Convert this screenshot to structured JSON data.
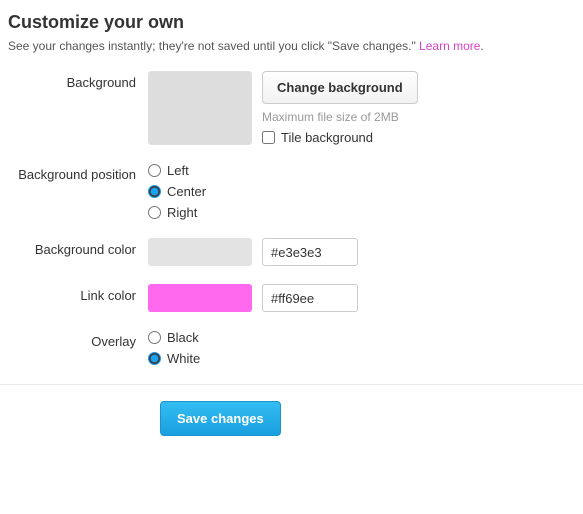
{
  "heading": "Customize your own",
  "sub_text": "See your changes instantly; they're not saved until you click \"Save changes.\" ",
  "learn_more": "Learn more",
  "rows": {
    "background": {
      "label": "Background",
      "button": "Change background",
      "hint": "Maximum file size of 2MB",
      "tile_label": "Tile background",
      "tile_checked": false
    },
    "position": {
      "label": "Background position",
      "options": [
        "Left",
        "Center",
        "Right"
      ],
      "selected": "Center"
    },
    "bgcolor": {
      "label": "Background color",
      "value": "#e3e3e3"
    },
    "linkcolor": {
      "label": "Link color",
      "value": "#ff69ee"
    },
    "overlay": {
      "label": "Overlay",
      "options": [
        "Black",
        "White"
      ],
      "selected": "White"
    }
  },
  "save_button": "Save changes"
}
